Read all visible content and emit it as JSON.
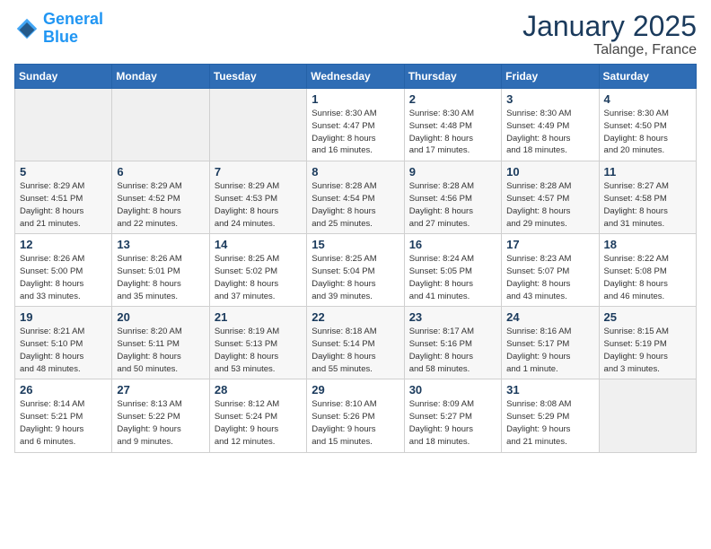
{
  "logo": {
    "text_general": "General",
    "text_blue": "Blue"
  },
  "header": {
    "title": "January 2025",
    "subtitle": "Talange, France"
  },
  "days_of_week": [
    "Sunday",
    "Monday",
    "Tuesday",
    "Wednesday",
    "Thursday",
    "Friday",
    "Saturday"
  ],
  "weeks": [
    [
      {
        "num": "",
        "info": ""
      },
      {
        "num": "",
        "info": ""
      },
      {
        "num": "",
        "info": ""
      },
      {
        "num": "1",
        "info": "Sunrise: 8:30 AM\nSunset: 4:47 PM\nDaylight: 8 hours\nand 16 minutes."
      },
      {
        "num": "2",
        "info": "Sunrise: 8:30 AM\nSunset: 4:48 PM\nDaylight: 8 hours\nand 17 minutes."
      },
      {
        "num": "3",
        "info": "Sunrise: 8:30 AM\nSunset: 4:49 PM\nDaylight: 8 hours\nand 18 minutes."
      },
      {
        "num": "4",
        "info": "Sunrise: 8:30 AM\nSunset: 4:50 PM\nDaylight: 8 hours\nand 20 minutes."
      }
    ],
    [
      {
        "num": "5",
        "info": "Sunrise: 8:29 AM\nSunset: 4:51 PM\nDaylight: 8 hours\nand 21 minutes."
      },
      {
        "num": "6",
        "info": "Sunrise: 8:29 AM\nSunset: 4:52 PM\nDaylight: 8 hours\nand 22 minutes."
      },
      {
        "num": "7",
        "info": "Sunrise: 8:29 AM\nSunset: 4:53 PM\nDaylight: 8 hours\nand 24 minutes."
      },
      {
        "num": "8",
        "info": "Sunrise: 8:28 AM\nSunset: 4:54 PM\nDaylight: 8 hours\nand 25 minutes."
      },
      {
        "num": "9",
        "info": "Sunrise: 8:28 AM\nSunset: 4:56 PM\nDaylight: 8 hours\nand 27 minutes."
      },
      {
        "num": "10",
        "info": "Sunrise: 8:28 AM\nSunset: 4:57 PM\nDaylight: 8 hours\nand 29 minutes."
      },
      {
        "num": "11",
        "info": "Sunrise: 8:27 AM\nSunset: 4:58 PM\nDaylight: 8 hours\nand 31 minutes."
      }
    ],
    [
      {
        "num": "12",
        "info": "Sunrise: 8:26 AM\nSunset: 5:00 PM\nDaylight: 8 hours\nand 33 minutes."
      },
      {
        "num": "13",
        "info": "Sunrise: 8:26 AM\nSunset: 5:01 PM\nDaylight: 8 hours\nand 35 minutes."
      },
      {
        "num": "14",
        "info": "Sunrise: 8:25 AM\nSunset: 5:02 PM\nDaylight: 8 hours\nand 37 minutes."
      },
      {
        "num": "15",
        "info": "Sunrise: 8:25 AM\nSunset: 5:04 PM\nDaylight: 8 hours\nand 39 minutes."
      },
      {
        "num": "16",
        "info": "Sunrise: 8:24 AM\nSunset: 5:05 PM\nDaylight: 8 hours\nand 41 minutes."
      },
      {
        "num": "17",
        "info": "Sunrise: 8:23 AM\nSunset: 5:07 PM\nDaylight: 8 hours\nand 43 minutes."
      },
      {
        "num": "18",
        "info": "Sunrise: 8:22 AM\nSunset: 5:08 PM\nDaylight: 8 hours\nand 46 minutes."
      }
    ],
    [
      {
        "num": "19",
        "info": "Sunrise: 8:21 AM\nSunset: 5:10 PM\nDaylight: 8 hours\nand 48 minutes."
      },
      {
        "num": "20",
        "info": "Sunrise: 8:20 AM\nSunset: 5:11 PM\nDaylight: 8 hours\nand 50 minutes."
      },
      {
        "num": "21",
        "info": "Sunrise: 8:19 AM\nSunset: 5:13 PM\nDaylight: 8 hours\nand 53 minutes."
      },
      {
        "num": "22",
        "info": "Sunrise: 8:18 AM\nSunset: 5:14 PM\nDaylight: 8 hours\nand 55 minutes."
      },
      {
        "num": "23",
        "info": "Sunrise: 8:17 AM\nSunset: 5:16 PM\nDaylight: 8 hours\nand 58 minutes."
      },
      {
        "num": "24",
        "info": "Sunrise: 8:16 AM\nSunset: 5:17 PM\nDaylight: 9 hours\nand 1 minute."
      },
      {
        "num": "25",
        "info": "Sunrise: 8:15 AM\nSunset: 5:19 PM\nDaylight: 9 hours\nand 3 minutes."
      }
    ],
    [
      {
        "num": "26",
        "info": "Sunrise: 8:14 AM\nSunset: 5:21 PM\nDaylight: 9 hours\nand 6 minutes."
      },
      {
        "num": "27",
        "info": "Sunrise: 8:13 AM\nSunset: 5:22 PM\nDaylight: 9 hours\nand 9 minutes."
      },
      {
        "num": "28",
        "info": "Sunrise: 8:12 AM\nSunset: 5:24 PM\nDaylight: 9 hours\nand 12 minutes."
      },
      {
        "num": "29",
        "info": "Sunrise: 8:10 AM\nSunset: 5:26 PM\nDaylight: 9 hours\nand 15 minutes."
      },
      {
        "num": "30",
        "info": "Sunrise: 8:09 AM\nSunset: 5:27 PM\nDaylight: 9 hours\nand 18 minutes."
      },
      {
        "num": "31",
        "info": "Sunrise: 8:08 AM\nSunset: 5:29 PM\nDaylight: 9 hours\nand 21 minutes."
      },
      {
        "num": "",
        "info": ""
      }
    ]
  ]
}
